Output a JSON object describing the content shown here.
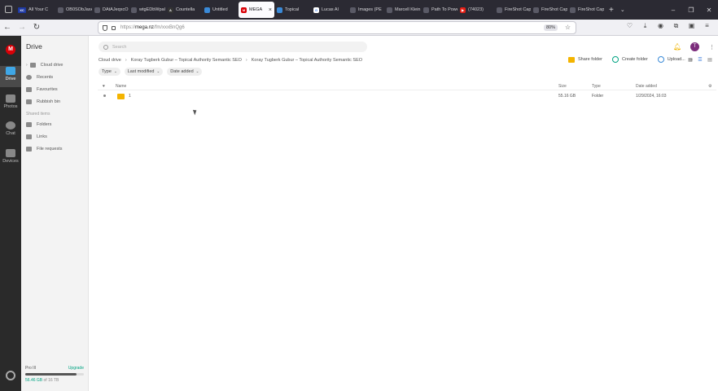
{
  "browser": {
    "tabs": [
      {
        "label": "All Your C",
        "fav": "XC",
        "color": "#1f3aa3"
      },
      {
        "label": "OB0SObJaxA",
        "fav": "",
        "color": ""
      },
      {
        "label": "DAtAJeqxcO",
        "fav": "",
        "color": ""
      },
      {
        "label": "wtgEDbWpaC",
        "fav": "",
        "color": ""
      },
      {
        "label": "Countella",
        "fav": "A",
        "color": "#333333"
      },
      {
        "label": "Untitled",
        "fav": "",
        "color": "#3a8ad8"
      },
      {
        "label": "MEGA",
        "fav": "M",
        "color": "#d90007",
        "active": true
      },
      {
        "label": "Topical",
        "fav": "",
        "color": "#3a8ad8"
      },
      {
        "label": "Lucas Al",
        "fav": "G",
        "color": "#ffffff"
      },
      {
        "label": "Images (PE",
        "fav": "",
        "color": ""
      },
      {
        "label": "Marcell Klein",
        "fav": "",
        "color": ""
      },
      {
        "label": "Path To Power",
        "fav": "",
        "color": ""
      },
      {
        "label": "(74023)",
        "fav": "▶",
        "color": "#e62117"
      },
      {
        "label": "FireShot Capture",
        "fav": "",
        "color": ""
      },
      {
        "label": "FireShot Capture",
        "fav": "",
        "color": ""
      },
      {
        "label": "FireShot Capture",
        "fav": "",
        "color": ""
      }
    ],
    "new_tab": "+",
    "url_prefix": "https://",
    "url_host": "mega.nz",
    "url_path": "/fm/xxxBnQg6",
    "zoom": "80%"
  },
  "rail": {
    "logo": "M",
    "items": [
      {
        "label": "Drive",
        "icon": "cloud-drive-icon",
        "active": true
      },
      {
        "label": "Photos",
        "icon": "photos-icon",
        "active": false
      },
      {
        "label": "Chat",
        "icon": "chat-icon",
        "active": false
      },
      {
        "label": "Devices",
        "icon": "devices-icon",
        "active": false
      }
    ]
  },
  "sidebar": {
    "title": "Drive",
    "items": [
      {
        "label": "Cloud drive",
        "icon": "cloud-icon"
      },
      {
        "label": "Recents",
        "icon": "clock-icon"
      },
      {
        "label": "Favourites",
        "icon": "heart-icon"
      },
      {
        "label": "Rubbish bin",
        "icon": "trash-icon"
      }
    ],
    "section_label": "Shared items",
    "shared_items": [
      {
        "label": "Folders",
        "icon": "shared-folder-icon"
      },
      {
        "label": "Links",
        "icon": "link-icon"
      },
      {
        "label": "File requests",
        "icon": "file-request-icon"
      }
    ],
    "plan": "Pro III",
    "upgrade": "Upgrade",
    "storage_used": "56.46 GB",
    "storage_total": "of 16 TB",
    "storage_fraction": 0.88
  },
  "main": {
    "search_placeholder": "Search",
    "avatar_letter": "T",
    "breadcrumbs": [
      "Cloud drive",
      "Koray Tugberk Gubur – Topical Authority Semantic SEO",
      "Koray Tugberk Gubur – Topical Authority Semantic SEO"
    ],
    "actions": {
      "share_folder": "Share folder",
      "create_folder": "Create folder",
      "upload": "Upload..."
    },
    "filters": [
      "Type",
      "Last modified",
      "Date added"
    ],
    "columns": {
      "fav": "♥",
      "name": "Name",
      "size": "Size",
      "type": "Type",
      "date": "Date added"
    },
    "rows": [
      {
        "name": "1",
        "size": "55.16 GB",
        "type": "Folder",
        "date": "1/29/2024, 16:03"
      }
    ]
  }
}
